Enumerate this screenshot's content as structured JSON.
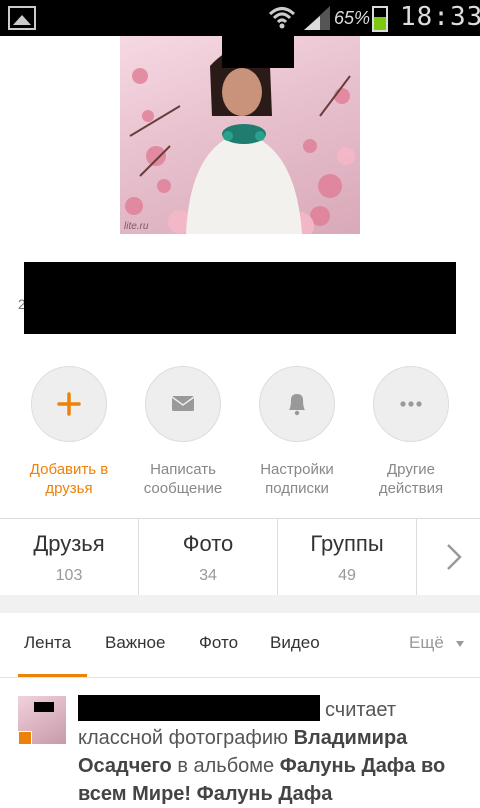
{
  "status_bar": {
    "battery_percent": "65%",
    "time": "18:33",
    "battery_level": 0.65,
    "icons": [
      "gallery-icon",
      "wifi-icon",
      "signal-icon",
      "battery-icon"
    ]
  },
  "profile": {
    "photo_watermark": "lite.ru",
    "name_peek": "2"
  },
  "actions": [
    {
      "line1": "Добавить в",
      "line2": "друзья",
      "icon": "plus-icon"
    },
    {
      "line1": "Написать",
      "line2": "сообщение",
      "icon": "envelope-icon"
    },
    {
      "line1": "Настройки",
      "line2": "подписки",
      "icon": "bell-icon"
    },
    {
      "line1": "Другие",
      "line2": "действия",
      "icon": "more-dots-icon"
    }
  ],
  "stats": [
    {
      "title": "Друзья",
      "count": "103"
    },
    {
      "title": "Фото",
      "count": "34"
    },
    {
      "title": "Группы",
      "count": "49"
    }
  ],
  "tabs": {
    "items": [
      "Лента",
      "Важное",
      "Фото",
      "Видео"
    ],
    "more": "Ещё",
    "active": "Лента"
  },
  "feed": {
    "verb": "считает",
    "text1": "классной фотографию",
    "author": "Владимира Осадчего",
    "text2": "в альбоме",
    "album": "Фалунь Дафа во всем Мире! Фалунь Дафа"
  },
  "colors": {
    "accent": "#ee8208",
    "muted": "#888888"
  }
}
